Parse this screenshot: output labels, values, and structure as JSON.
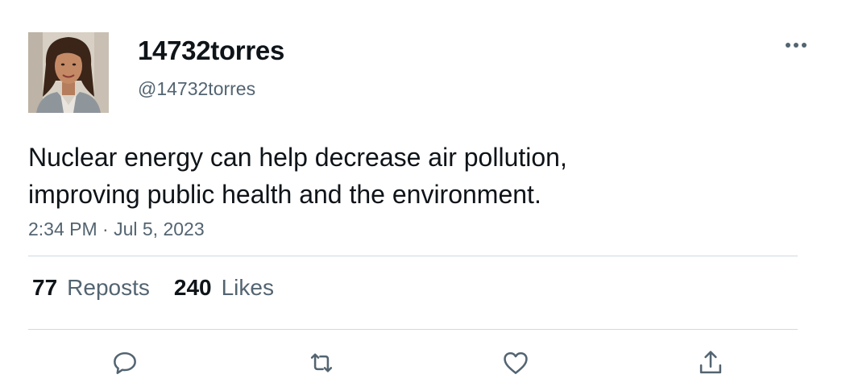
{
  "author": {
    "display_name": "14732torres",
    "handle": "@14732torres"
  },
  "tweet": {
    "text_lines": [
      "Nuclear energy can help decrease air pollution,",
      "improving public health and the environment."
    ],
    "timestamp": "2:34 PM · Jul 5, 2023"
  },
  "stats": {
    "reposts_count": "77",
    "reposts_label": "Reposts",
    "likes_count": "240",
    "likes_label": "Likes"
  },
  "icons": {
    "more": "more-horizontal-icon",
    "reply": "reply-icon",
    "repost": "repost-icon",
    "like": "heart-icon",
    "share": "share-icon"
  },
  "colors": {
    "text_primary": "#0f1419",
    "text_secondary": "#536471",
    "divider": "#cfd9de"
  }
}
